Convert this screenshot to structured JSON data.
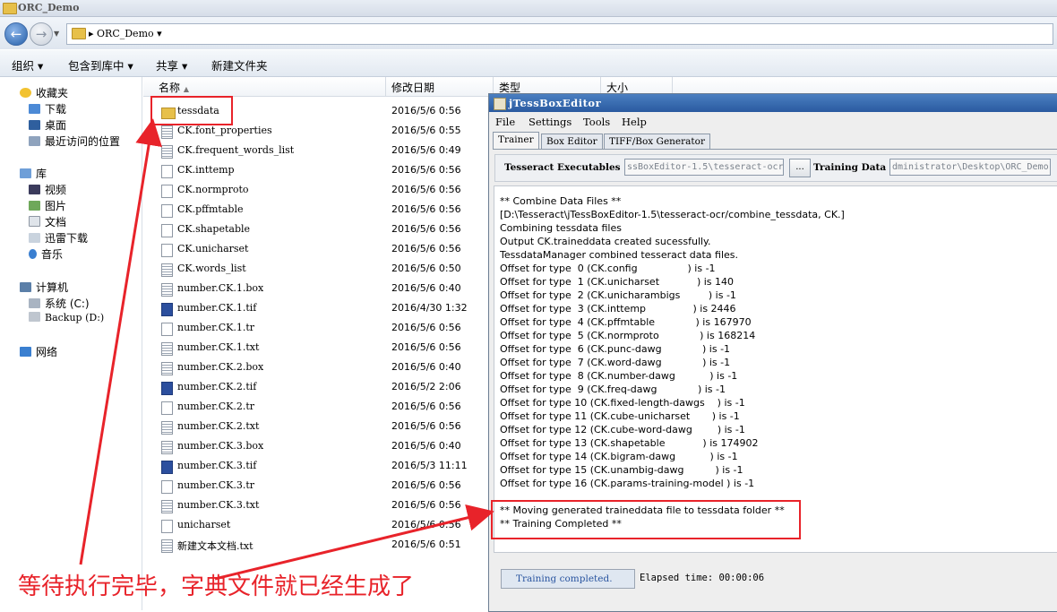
{
  "explorer": {
    "title": "ORC_Demo",
    "address_path": "▸ ORC_Demo ▾",
    "commands": [
      "组织 ▾",
      "包含到库中 ▾",
      "共享 ▾",
      "新建文件夹"
    ],
    "nav": {
      "favorites": "收藏夹",
      "downloads": "下载",
      "desktop": "桌面",
      "recent": "最近访问的位置",
      "libraries": "库",
      "videos": "视频",
      "pictures": "图片",
      "documents": "文档",
      "thunder": "迅雷下载",
      "music": "音乐",
      "computer": "计算机",
      "drive_c": "系统 (C:)",
      "drive_d": "Backup (D:)",
      "network": "网络"
    },
    "columns": {
      "name": "名称",
      "date": "修改日期",
      "type": "类型",
      "size": "大小"
    },
    "files": [
      {
        "name": "tessdata",
        "date": "2016/5/6 0:56"
      },
      {
        "name": "CK.font_properties",
        "date": "2016/5/6 0:55"
      },
      {
        "name": "CK.frequent_words_list",
        "date": "2016/5/6 0:49"
      },
      {
        "name": "CK.inttemp",
        "date": "2016/5/6 0:56"
      },
      {
        "name": "CK.normproto",
        "date": "2016/5/6 0:56"
      },
      {
        "name": "CK.pffmtable",
        "date": "2016/5/6 0:56"
      },
      {
        "name": "CK.shapetable",
        "date": "2016/5/6 0:56"
      },
      {
        "name": "CK.unicharset",
        "date": "2016/5/6 0:56"
      },
      {
        "name": "CK.words_list",
        "date": "2016/5/6 0:50"
      },
      {
        "name": "number.CK.1.box",
        "date": "2016/5/6 0:40"
      },
      {
        "name": "number.CK.1.tif",
        "date": "2016/4/30 1:32"
      },
      {
        "name": "number.CK.1.tr",
        "date": "2016/5/6 0:56"
      },
      {
        "name": "number.CK.1.txt",
        "date": "2016/5/6 0:56"
      },
      {
        "name": "number.CK.2.box",
        "date": "2016/5/6 0:40"
      },
      {
        "name": "number.CK.2.tif",
        "date": "2016/5/2 2:06"
      },
      {
        "name": "number.CK.2.tr",
        "date": "2016/5/6 0:56"
      },
      {
        "name": "number.CK.2.txt",
        "date": "2016/5/6 0:56"
      },
      {
        "name": "number.CK.3.box",
        "date": "2016/5/6 0:40"
      },
      {
        "name": "number.CK.3.tif",
        "date": "2016/5/3 11:11"
      },
      {
        "name": "number.CK.3.tr",
        "date": "2016/5/6 0:56"
      },
      {
        "name": "number.CK.3.txt",
        "date": "2016/5/6 0:56"
      },
      {
        "name": "unicharset",
        "date": "2016/5/6 0:56"
      },
      {
        "name": "新建文本文档.txt",
        "date": "2016/5/6 0:51"
      }
    ]
  },
  "jtess": {
    "title": "jTessBoxEditor",
    "menu": [
      "File",
      "Settings",
      "Tools",
      "Help"
    ],
    "tabs": [
      "Trainer",
      "Box Editor",
      "TIFF/Box Generator"
    ],
    "tesseract_label": "Tesseract Executables",
    "tesseract_value": "ssBoxEditor-1.5\\tesseract-ocr",
    "browse_label": "...",
    "training_label": "Training Data",
    "training_value": "dministrator\\Desktop\\ORC_Demo",
    "output_lines": [
      "** Combine Data Files **",
      "[D:\\Tesseract\\jTessBoxEditor-1.5\\tesseract-ocr/combine_tessdata, CK.]",
      "Combining tessdata files",
      "Output CK.traineddata created sucessfully.",
      "TessdataManager combined tesseract data files.",
      "Offset for type  0 (CK.config                ) is -1",
      "Offset for type  1 (CK.unicharset            ) is 140",
      "Offset for type  2 (CK.unicharambigs         ) is -1",
      "Offset for type  3 (CK.inttemp               ) is 2446",
      "Offset for type  4 (CK.pffmtable             ) is 167970",
      "Offset for type  5 (CK.normproto             ) is 168214",
      "Offset for type  6 (CK.punc-dawg             ) is -1",
      "Offset for type  7 (CK.word-dawg             ) is -1",
      "Offset for type  8 (CK.number-dawg           ) is -1",
      "Offset for type  9 (CK.freq-dawg             ) is -1",
      "Offset for type 10 (CK.fixed-length-dawgs    ) is -1",
      "Offset for type 11 (CK.cube-unicharset       ) is -1",
      "Offset for type 12 (CK.cube-word-dawg        ) is -1",
      "Offset for type 13 (CK.shapetable            ) is 174902",
      "Offset for type 14 (CK.bigram-dawg           ) is -1",
      "Offset for type 15 (CK.unambig-dawg          ) is -1",
      "Offset for type 16 (CK.params-training-model ) is -1",
      "",
      "** Moving generated traineddata file to tessdata folder **",
      "** Training Completed **"
    ],
    "status": "Training completed.",
    "elapsed": "Elapsed time: 00:00:06"
  },
  "annotation": {
    "caption": "等待执行完毕，字典文件就已经生成了",
    "color": "#e8232a"
  }
}
